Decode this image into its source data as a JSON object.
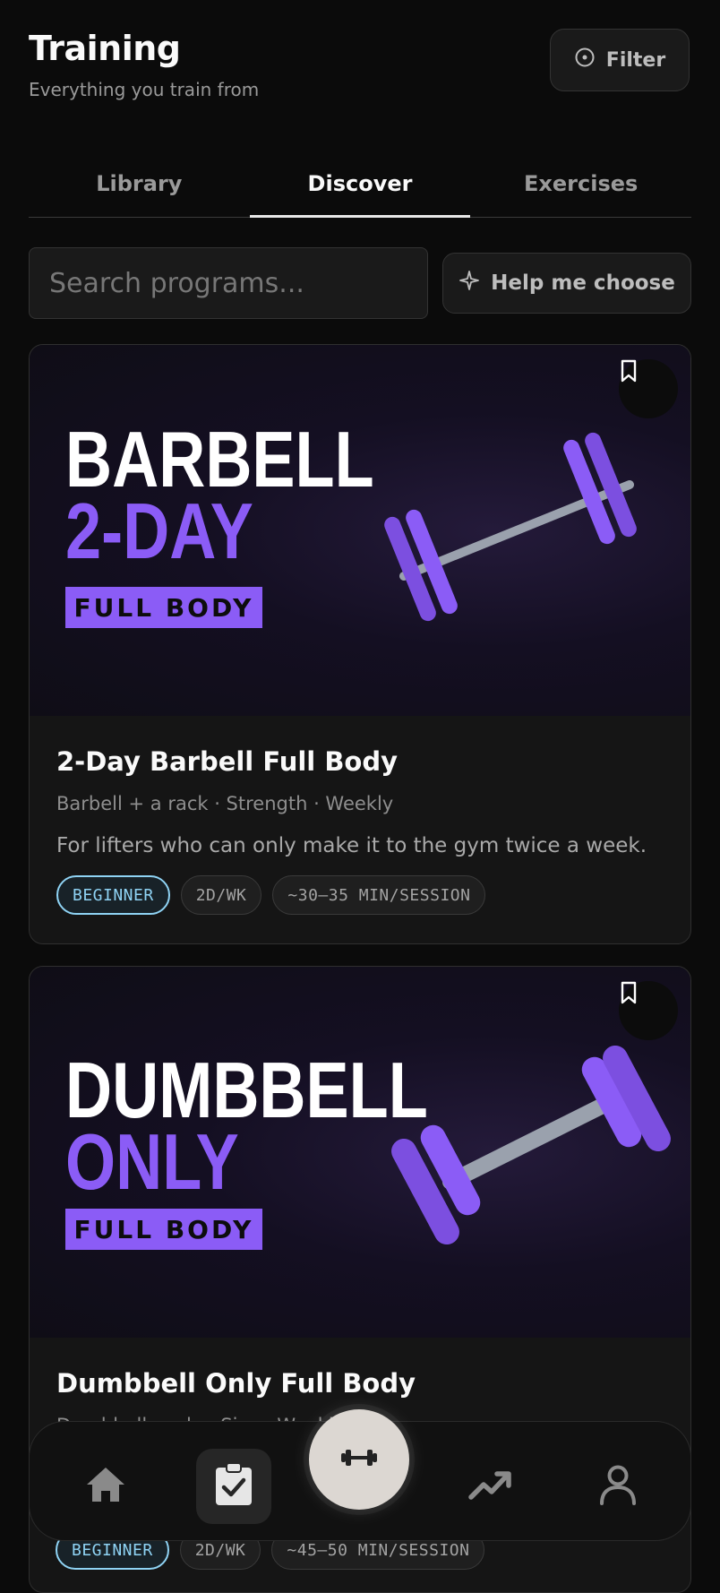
{
  "header": {
    "title": "Training",
    "subtitle": "Everything you train from",
    "filter_label": "Filter"
  },
  "tabs": [
    {
      "label": "Library",
      "active": false
    },
    {
      "label": "Discover",
      "active": true
    },
    {
      "label": "Exercises",
      "active": false
    }
  ],
  "search": {
    "placeholder": "Search programs...",
    "help_label": "Help me choose"
  },
  "programs": [
    {
      "art": {
        "line1": "BARBELL",
        "line2": "2-DAY",
        "banner": "FULL BODY"
      },
      "title": "2-Day Barbell Full Body",
      "meta": "Barbell + a rack · Strength · Weekly",
      "description": "For lifters who can only make it to the gym twice a week.",
      "level": "BEGINNER",
      "frequency": "2D/WK",
      "duration": "~30–35 MIN/SESSION"
    },
    {
      "art": {
        "line1": "DUMBBELL",
        "line2": "ONLY",
        "banner": "FULL BODY"
      },
      "title": "Dumbbell Only Full Body",
      "meta": "Dumbbells only · Size · Weekly",
      "level": "BEGINNER",
      "frequency": "2D/WK",
      "duration": "~45–50 MIN/SESSION"
    }
  ],
  "bottom_nav": {
    "items": [
      "home-icon",
      "clipboard-check-icon",
      "dumbbell-icon",
      "trending-up-icon",
      "user-icon"
    ],
    "active": "clipboard-check-icon"
  },
  "colors": {
    "background": "#0b0b0b",
    "accent_purple": "#8b5cf6",
    "level_badge": "#8fd3f4"
  }
}
